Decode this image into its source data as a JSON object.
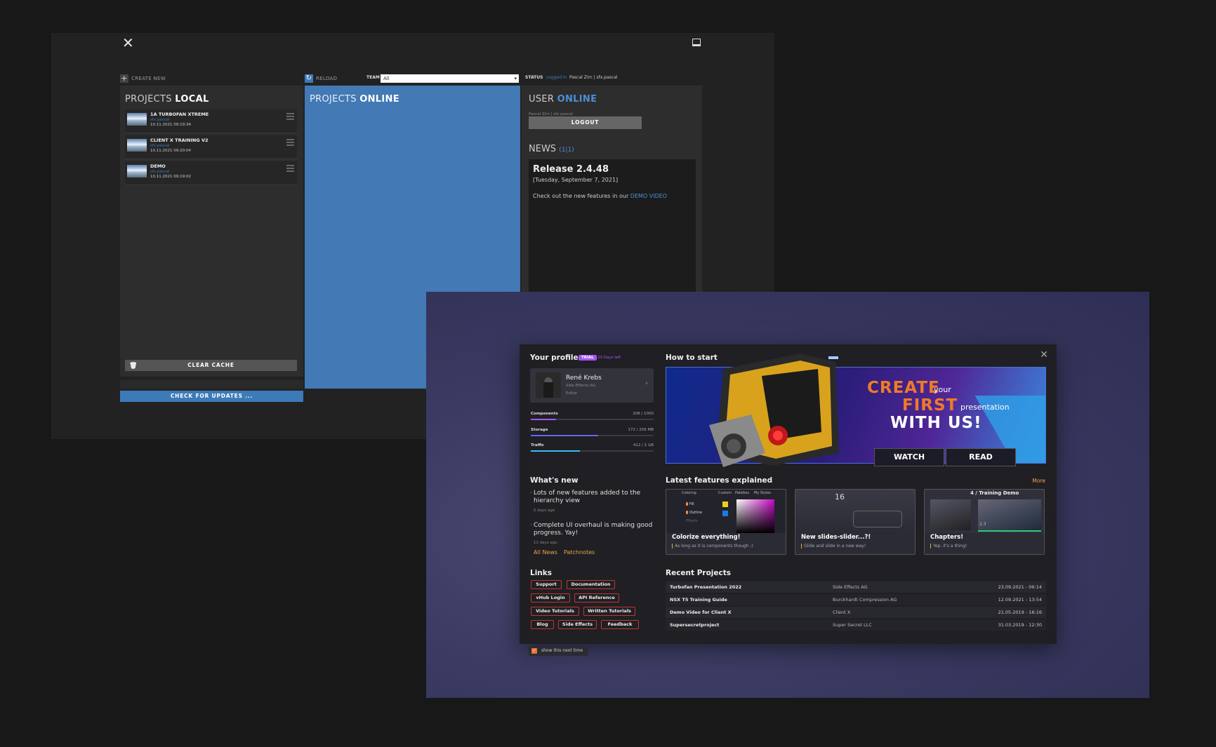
{
  "old_window": {
    "close_icon": "close-icon",
    "create_new_label": "CREATE NEW",
    "reload_label": "RELOAD",
    "team_label": "TEAM",
    "team_value": "All",
    "status_label": "STATUS",
    "status_logged_in": "Logged In",
    "status_user": "Pascal Zirn | sfx.pascal",
    "local": {
      "title_prefix": "PROJECTS",
      "title_strong": "LOCAL",
      "projects": [
        {
          "name": "1A TURBOFAN XTREME",
          "user": "sfx.pascal",
          "date": "10.11.2021 09:19:34"
        },
        {
          "name": "CLIENT X TRAINING V2",
          "user": "sfx.pascal",
          "date": "10.11.2021 09:20:04"
        },
        {
          "name": "DEMO",
          "user": "sfx.pascal",
          "date": "10.11.2021 09:19:02"
        }
      ],
      "clear_cache": "CLEAR CACHE",
      "check_updates": "CHECK FOR UPDATES ..."
    },
    "online": {
      "title_prefix": "PROJECTS",
      "title_strong": "ONLINE"
    },
    "user": {
      "title_prefix": "USER",
      "title_strong": "ONLINE",
      "name_line": "Pascal Zirn | sfx.pascal",
      "logout": "LOGOUT",
      "news_title": "NEWS",
      "news_count": "(1|1)",
      "release_title": "Release 2.4.48",
      "release_date": "[Tuesday, September 7, 2021]",
      "release_text": "Check out the new features in our ",
      "release_link": "DEMO VIDEO"
    }
  },
  "new_window": {
    "profile": {
      "title": "Your profile",
      "badge": "TRIAL",
      "days_left": "23 Days left",
      "name": "René Krebs",
      "company": "Side Effects AG",
      "role": "Editor"
    },
    "meters": [
      {
        "label": "Components",
        "value": "208 / 1000",
        "fraction": 0.208,
        "color": "#a855f7"
      },
      {
        "label": "Storage",
        "value": "172 / 256 MB",
        "fraction": 0.55,
        "color": "#6366f1"
      },
      {
        "label": "Traffic",
        "value": "412 / 1 GB",
        "fraction": 0.4,
        "color": "#38bdf8"
      }
    ],
    "whats_new": {
      "title": "What's new",
      "items": [
        {
          "text": "Lots of new features added to the hierarchy view",
          "age": "5 days ago"
        },
        {
          "text": "Complete UI overhaul is making good progress. Yay!",
          "age": "12 days ago"
        }
      ],
      "all_news": "All News",
      "patchnotes": "Patchnotes"
    },
    "links": {
      "title": "Links",
      "items": [
        "Support",
        "Documentation",
        "vHub Login",
        "API Reference",
        "Video Tutorials",
        "Written Tutorials",
        "Blog",
        "Side Effects",
        "Feedback"
      ]
    },
    "how_to_start": {
      "title": "How to start",
      "line1_a": "CREATE",
      "line1_b": "your",
      "line2_a": "FIRST",
      "line2_b": "presentation",
      "line3": "WITH US!",
      "watch": "WATCH",
      "read": "READ"
    },
    "features": {
      "title": "Latest features explained",
      "more": "More",
      "cards": [
        {
          "title": "Colorize everything!",
          "sub": "As long as it is components though ;)"
        },
        {
          "title": "New slides-slider...?!",
          "sub": "Glide and slide in a new way!"
        },
        {
          "title": "Chapters!",
          "sub": "Yep, it's a thing!"
        }
      ],
      "card1_tabs": [
        "Coloring",
        "Custom",
        "Palettes",
        "My Styles"
      ],
      "card1_opts": [
        "Fill",
        "Outline",
        "Effects"
      ],
      "card2_num": "16",
      "card3_label": "4 / Training Demo",
      "card3_num": "2.3"
    },
    "recent": {
      "title": "Recent Projects",
      "rows": [
        {
          "name": "Turbofan Presentation 2022",
          "client": "Side Effects AG",
          "date": "23.09.2021 - 06:14"
        },
        {
          "name": "NSX T5 Training Guide",
          "client": "Burckhardt Compression AG",
          "date": "12.09.2021 - 13:54"
        },
        {
          "name": "Demo Video for Client X",
          "client": "Client X",
          "date": "21.05.2019 - 16:16"
        },
        {
          "name": "Supersecretproject",
          "client": "Super Secret LLC",
          "date": "31.03.2019 - 12:30"
        }
      ]
    },
    "show_next_time": "show this next time"
  }
}
